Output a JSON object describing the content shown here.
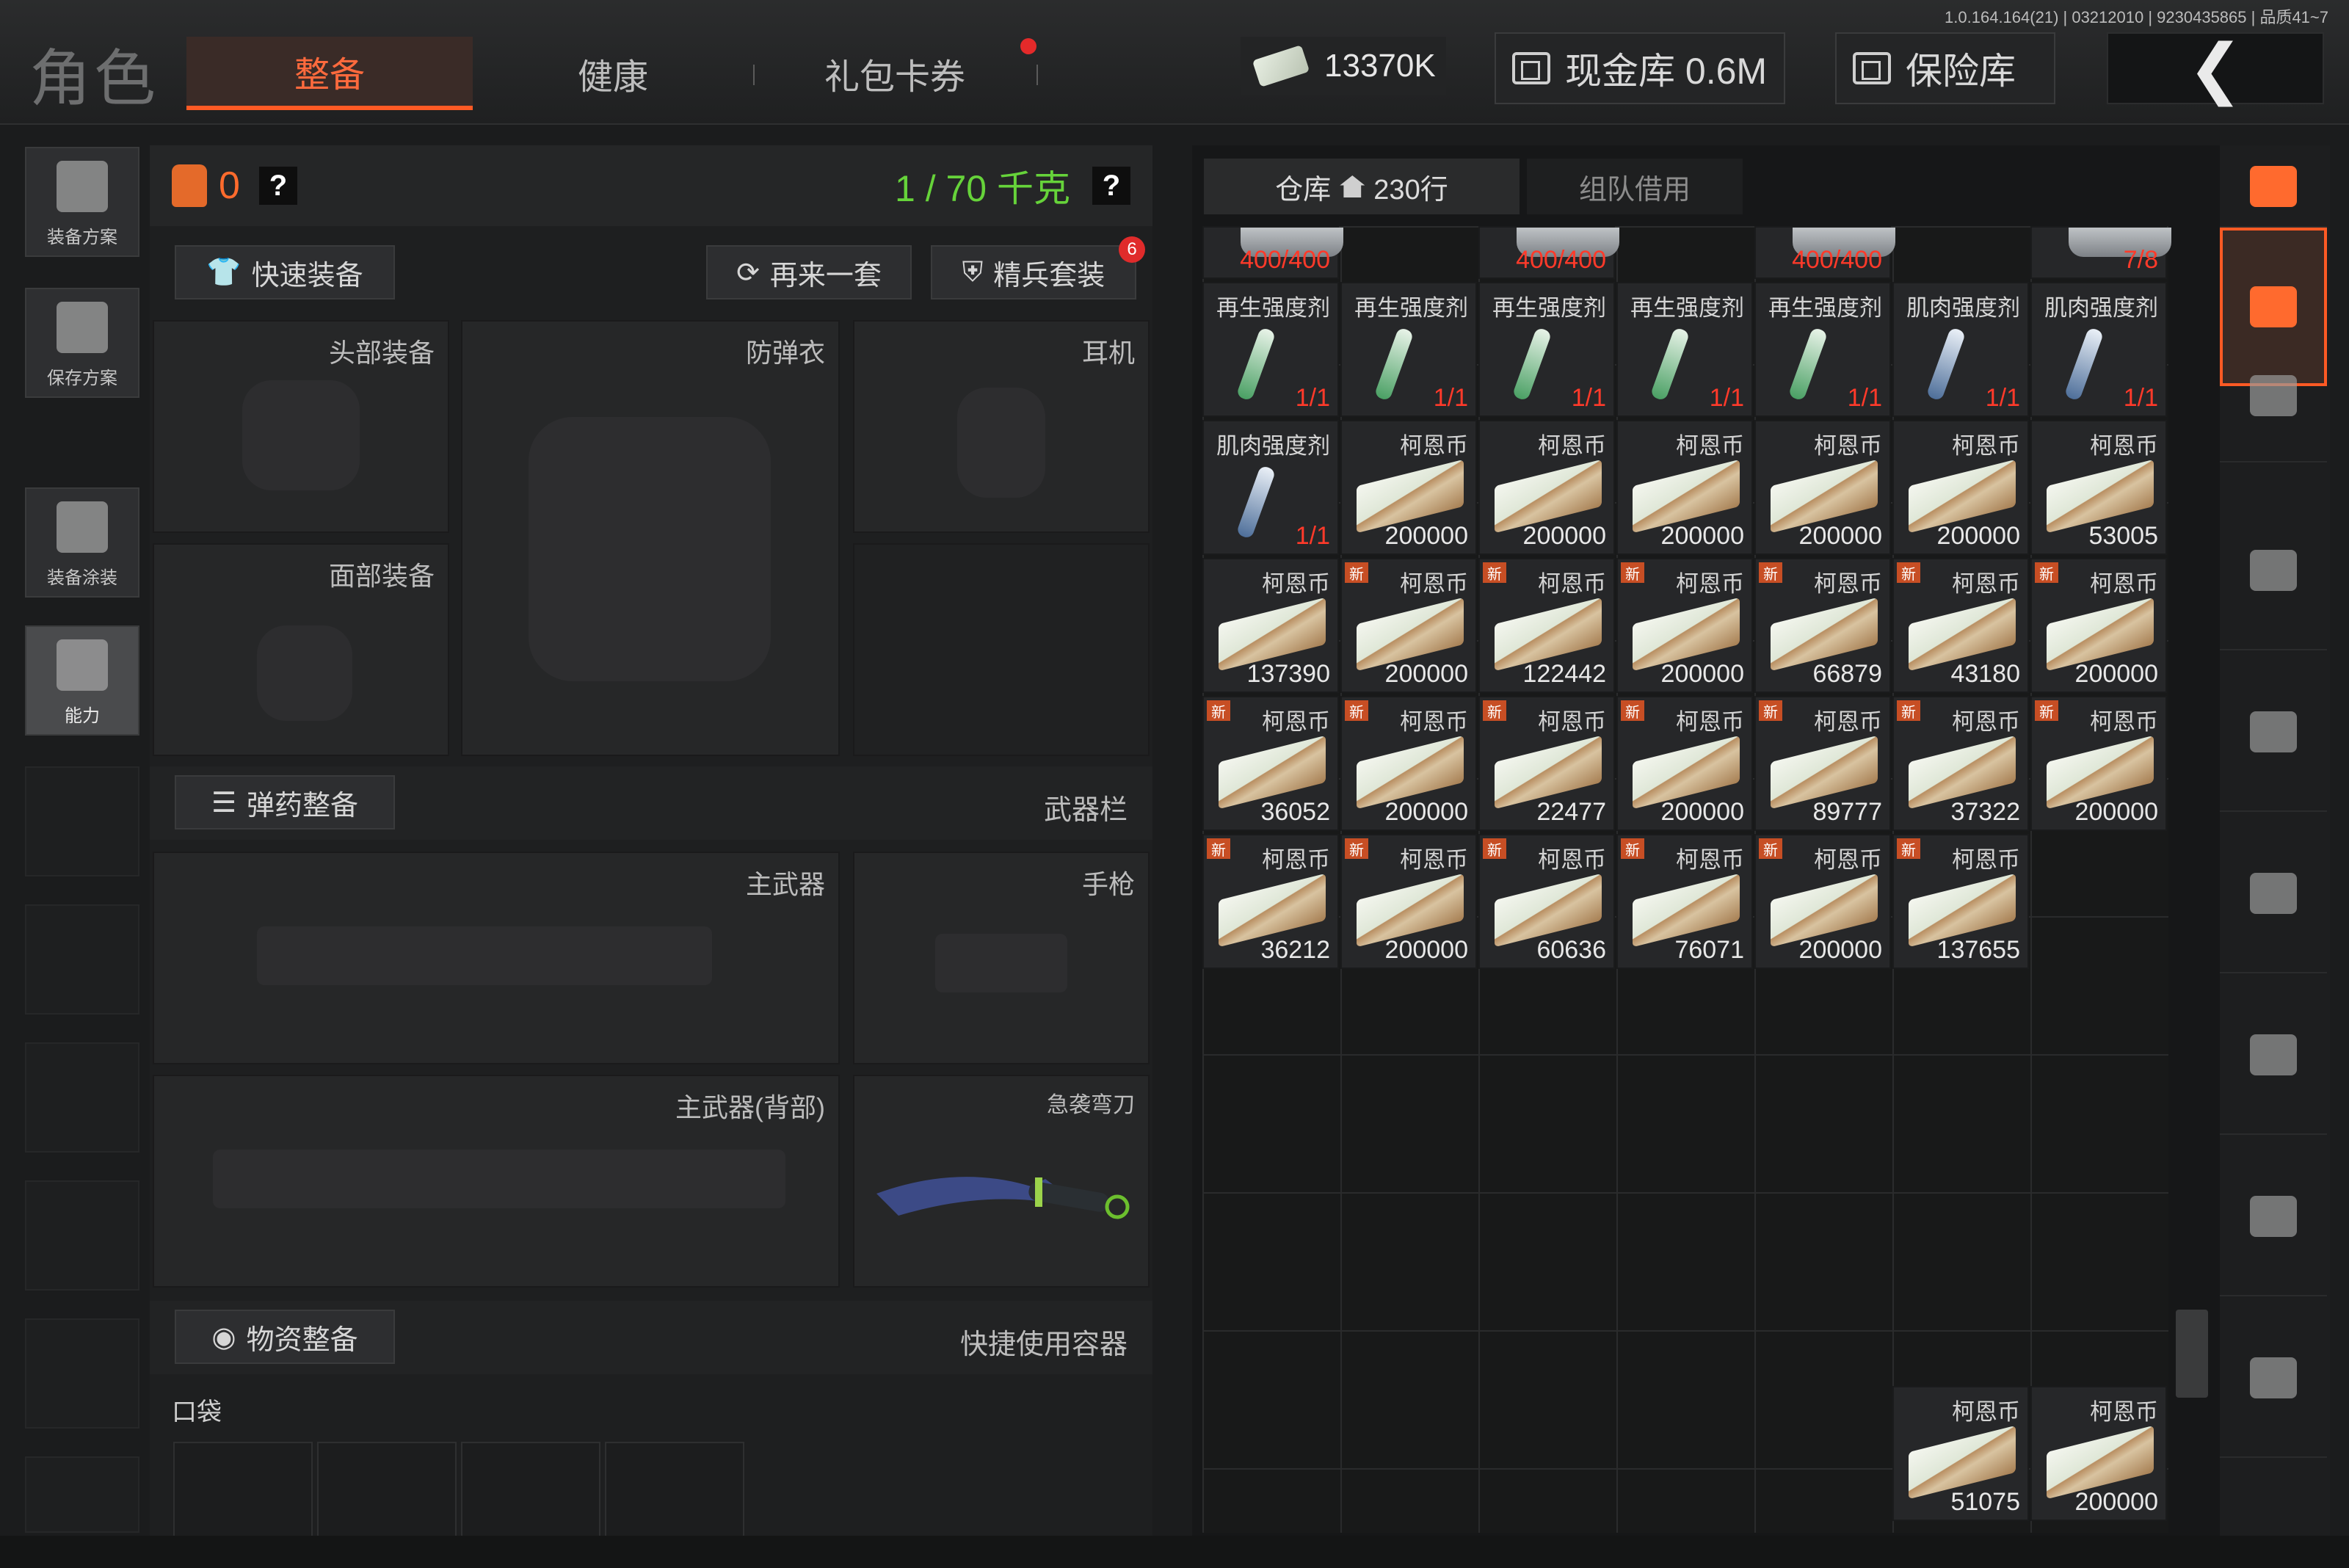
{
  "header": {
    "title": "角色",
    "tabs": [
      {
        "label": "整备",
        "active": true
      },
      {
        "label": "健康",
        "active": false
      },
      {
        "label": "礼包卡券",
        "active": false
      }
    ],
    "version": "1.0.164.164(21) | 03212010 | 9230435865 | 品质41~7",
    "money": "13370K",
    "vault_label": "现金库 0.6M",
    "safe_label": "保险库",
    "back_symbol": "❮"
  },
  "sidebar": {
    "items": [
      {
        "label": "装备方案"
      },
      {
        "label": "保存方案"
      },
      {
        "label": "装备涂装"
      },
      {
        "label": "能力"
      }
    ]
  },
  "equipment": {
    "bag_count": "0",
    "help": "?",
    "weight": "1 / 70 千克",
    "quick_equip": "快速装备",
    "again": "再来一套",
    "elite": "精兵套装",
    "elite_badge": "6",
    "slots": {
      "head": "头部装备",
      "armor": "防弹衣",
      "earphone": "耳机",
      "face": "面部装备",
      "primary": "主武器",
      "pistol": "手枪",
      "primary_back": "主武器(背部)",
      "melee": "急袭弯刀"
    },
    "ammo_btn": "弹药整备",
    "weapon_bar": "武器栏",
    "supply_btn": "物资整备",
    "quick_container": "快捷使用容器",
    "pocket": "口袋"
  },
  "warehouse": {
    "tab_label": "仓库",
    "rows": "230行",
    "team_tab": "组队借用",
    "top_row": [
      "400/400",
      "400/400",
      "400/400",
      "7/8"
    ],
    "rows_data": [
      [
        {
          "name": "再生强度剂",
          "qty": "1/1",
          "type": "tube",
          "red": true
        },
        {
          "name": "再生强度剂",
          "qty": "1/1",
          "type": "tube",
          "red": true
        },
        {
          "name": "再生强度剂",
          "qty": "1/1",
          "type": "tube",
          "red": true
        },
        {
          "name": "再生强度剂",
          "qty": "1/1",
          "type": "tube",
          "red": true
        },
        {
          "name": "再生强度剂",
          "qty": "1/1",
          "type": "tube",
          "red": true
        },
        {
          "name": "肌肉强度剂",
          "qty": "1/1",
          "type": "tube-blue",
          "red": true
        },
        {
          "name": "肌肉强度剂",
          "qty": "1/1",
          "type": "tube-blue",
          "red": true
        }
      ],
      [
        {
          "name": "肌肉强度剂",
          "qty": "1/1",
          "type": "tube-blue",
          "red": true
        },
        {
          "name": "柯恩币",
          "qty": "200000",
          "type": "cash"
        },
        {
          "name": "柯恩币",
          "qty": "200000",
          "type": "cash"
        },
        {
          "name": "柯恩币",
          "qty": "200000",
          "type": "cash"
        },
        {
          "name": "柯恩币",
          "qty": "200000",
          "type": "cash"
        },
        {
          "name": "柯恩币",
          "qty": "200000",
          "type": "cash"
        },
        {
          "name": "柯恩币",
          "qty": "53005",
          "type": "cash"
        }
      ],
      [
        {
          "name": "柯恩币",
          "qty": "137390",
          "type": "cash"
        },
        {
          "name": "柯恩币",
          "qty": "200000",
          "type": "cash",
          "new": true
        },
        {
          "name": "柯恩币",
          "qty": "122442",
          "type": "cash",
          "new": true
        },
        {
          "name": "柯恩币",
          "qty": "200000",
          "type": "cash",
          "new": true
        },
        {
          "name": "柯恩币",
          "qty": "66879",
          "type": "cash",
          "new": true
        },
        {
          "name": "柯恩币",
          "qty": "43180",
          "type": "cash",
          "new": true
        },
        {
          "name": "柯恩币",
          "qty": "200000",
          "type": "cash",
          "new": true
        }
      ],
      [
        {
          "name": "柯恩币",
          "qty": "36052",
          "type": "cash",
          "new": true
        },
        {
          "name": "柯恩币",
          "qty": "200000",
          "type": "cash",
          "new": true
        },
        {
          "name": "柯恩币",
          "qty": "22477",
          "type": "cash",
          "new": true
        },
        {
          "name": "柯恩币",
          "qty": "200000",
          "type": "cash",
          "new": true
        },
        {
          "name": "柯恩币",
          "qty": "89777",
          "type": "cash",
          "new": true
        },
        {
          "name": "柯恩币",
          "qty": "37322",
          "type": "cash",
          "new": true
        },
        {
          "name": "柯恩币",
          "qty": "200000",
          "type": "cash",
          "new": true
        }
      ],
      [
        {
          "name": "柯恩币",
          "qty": "36212",
          "type": "cash",
          "new": true
        },
        {
          "name": "柯恩币",
          "qty": "200000",
          "type": "cash",
          "new": true
        },
        {
          "name": "柯恩币",
          "qty": "60636",
          "type": "cash",
          "new": true
        },
        {
          "name": "柯恩币",
          "qty": "76071",
          "type": "cash",
          "new": true
        },
        {
          "name": "柯恩币",
          "qty": "200000",
          "type": "cash",
          "new": true
        },
        {
          "name": "柯恩币",
          "qty": "137655",
          "type": "cash",
          "new": true
        }
      ]
    ],
    "bottom_items": [
      {
        "name": "柯恩币",
        "qty": "51075",
        "type": "cash"
      },
      {
        "name": "柯恩币",
        "qty": "200000",
        "type": "cash"
      }
    ],
    "new_tag": "新"
  },
  "colors": {
    "accent": "#ff5a24",
    "weight_green": "#66d33a",
    "qty_red": "#ff3a2a",
    "new_tag": "#c74e24"
  }
}
